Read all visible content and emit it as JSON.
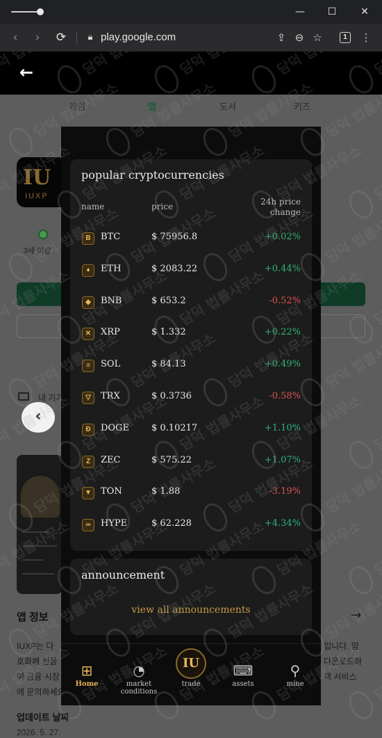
{
  "browser": {
    "url": "play.google.com",
    "tab_count": "1",
    "window_controls": [
      "minimize-icon",
      "maximize-icon",
      "close-icon"
    ],
    "nav_icons": [
      "back-icon",
      "forward-icon",
      "reload-icon",
      "lock-icon"
    ],
    "tool_icons": [
      "share-icon",
      "zoom-icon",
      "bookmark-icon",
      "tab-count-icon",
      "more-icon"
    ]
  },
  "store": {
    "tabs": [
      "게임",
      "앱",
      "도서",
      "키즈"
    ],
    "active_tab": "앱",
    "app_icon_text": "IU",
    "app_icon_subtext": "IUXP",
    "age_rating": "3세 이상",
    "device_label": "내 기기",
    "section_title": "앱 정보",
    "description_lines": [
      "IUXP는 다",
      "입니다. 암",
      "호화폐 선물",
      "다운로드하",
      "여 금융 시장",
      "객 서비스",
      "에 문의하세요"
    ],
    "update_label": "업데이트 날짜",
    "update_date": "2026. 5. 27."
  },
  "watermark_text": "담덕 법률사무소",
  "popular": {
    "title": "popular cryptocurrencies",
    "col_name": "name",
    "col_price": "price",
    "col_change_line1": "24h price",
    "col_change_line2": "change",
    "coins": [
      {
        "symbol": "BTC",
        "price": "$ 75956.8",
        "change": "+0.02%",
        "direction": "up",
        "icon": "B"
      },
      {
        "symbol": "ETH",
        "price": "$ 2083.22",
        "change": "+0.44%",
        "direction": "up",
        "icon": "♦"
      },
      {
        "symbol": "BNB",
        "price": "$ 653.2",
        "change": "-0.52%",
        "direction": "down",
        "icon": "◆"
      },
      {
        "symbol": "XRP",
        "price": "$ 1.332",
        "change": "+0.22%",
        "direction": "up",
        "icon": "✕"
      },
      {
        "symbol": "SOL",
        "price": "$ 84.13",
        "change": "+0.49%",
        "direction": "up",
        "icon": "≡"
      },
      {
        "symbol": "TRX",
        "price": "$ 0.3736",
        "change": "-0.58%",
        "direction": "down",
        "icon": "▽"
      },
      {
        "symbol": "DOGE",
        "price": "$ 0.10217",
        "change": "+1.10%",
        "direction": "up",
        "icon": "Ð"
      },
      {
        "symbol": "ZEC",
        "price": "$ 575.22",
        "change": "+1.07%",
        "direction": "up",
        "icon": "Z"
      },
      {
        "symbol": "TON",
        "price": "$ 1.88",
        "change": "-3.19%",
        "direction": "down",
        "icon": "▼"
      },
      {
        "symbol": "HYPE",
        "price": "$ 62.228",
        "change": "+4.34%",
        "direction": "up",
        "icon": "∞"
      }
    ],
    "up_color": "#2fb37c",
    "down_color": "#e05252"
  },
  "announcement": {
    "title": "announcement",
    "link": "view all announcements"
  },
  "bottom_nav": {
    "items": [
      {
        "label": "Home",
        "icon": "home-grid-icon",
        "active": true
      },
      {
        "label": "market conditions",
        "icon": "pie-chart-icon",
        "active": false
      },
      {
        "label": "trade",
        "icon": "iu-logo-icon",
        "active": false
      },
      {
        "label": "assets",
        "icon": "monitor-chart-icon",
        "active": false
      },
      {
        "label": "mine",
        "icon": "person-icon",
        "active": false
      }
    ],
    "trade_logo_text": "IU",
    "accent_color": "#e8b55a"
  }
}
